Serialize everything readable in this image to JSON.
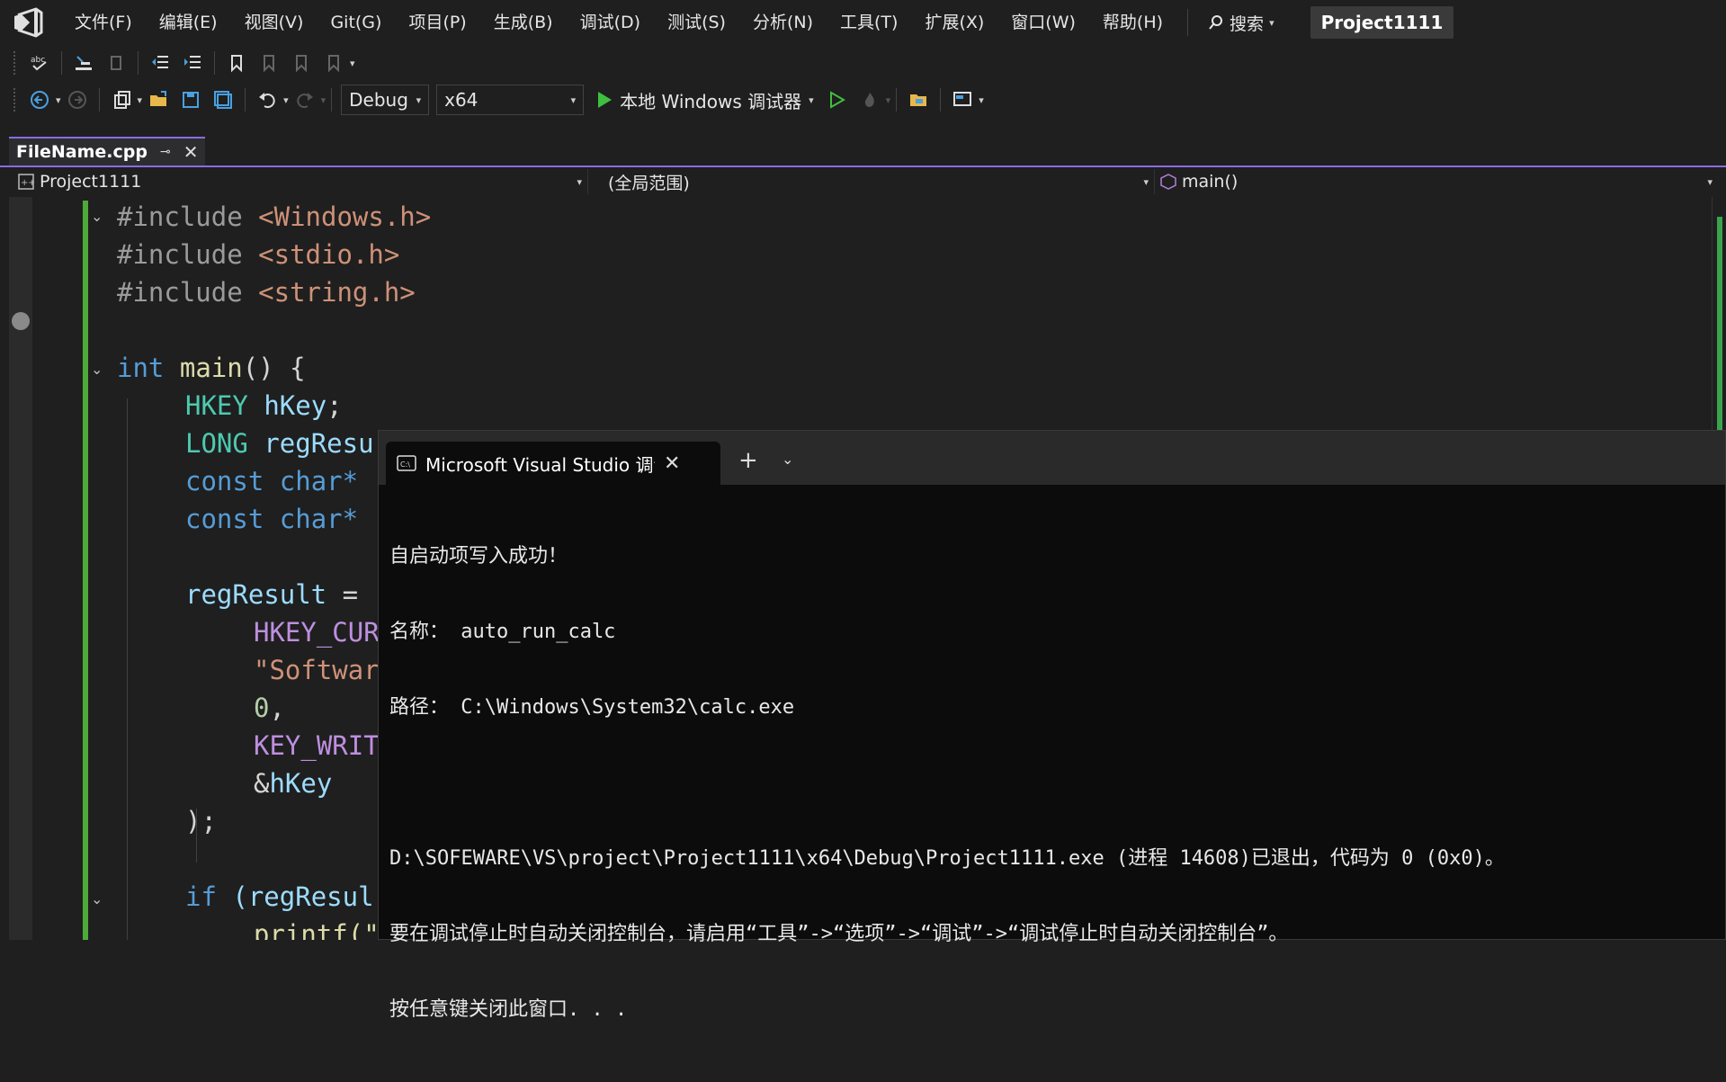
{
  "menu": {
    "items": [
      "文件(F)",
      "编辑(E)",
      "视图(V)",
      "Git(G)",
      "项目(P)",
      "生成(B)",
      "调试(D)",
      "测试(S)",
      "分析(N)",
      "工具(T)",
      "扩展(X)",
      "窗口(W)",
      "帮助(H)"
    ],
    "search_label": "搜索",
    "project_name": "Project1111"
  },
  "toolbar": {
    "config": "Debug",
    "platform": "x64",
    "run_label": "本地 Windows 调试器"
  },
  "document_tab": {
    "name": "FileName.cpp"
  },
  "navbar": {
    "project": "Project1111",
    "scope": "(全局范围)",
    "member": "main()"
  },
  "code": {
    "l1_dir": "#include",
    "l1_hdr": "<Windows.h>",
    "l2_dir": "#include",
    "l2_hdr": "<stdio.h>",
    "l3_dir": "#include",
    "l3_hdr": "<string.h>",
    "l5_type": "int",
    "l5_fn": "main",
    "l5_rest": "() {",
    "l6_type": "HKEY",
    "l6_var": "hKey",
    "l6_end": ";",
    "l7_type": "LONG",
    "l7_var": "regResu",
    "l8_kw": "const",
    "l8_type": "char*",
    "l9_kw": "const",
    "l9_type": "char*",
    "l11_var": "regResult",
    "l11_op": "=",
    "l12_mac": "HKEY_CUR",
    "l13_str": "\"Softwar",
    "l14_num": "0",
    "l14_end": ",",
    "l15_mac": "KEY_WRIT",
    "l16_amp": "&",
    "l16_var": "hKey",
    "l17_end": ");",
    "l19_kw": "if",
    "l19_rest": "(regResul",
    "l20_fn": "printf(\""
  },
  "terminal": {
    "tab_title": "Microsoft Visual Studio 调试",
    "lines": [
      "自启动项写入成功！",
      "名称： auto_run_calc",
      "路径： C:\\Windows\\System32\\calc.exe",
      "",
      "D:\\SOFEWARE\\VS\\project\\Project1111\\x64\\Debug\\Project1111.exe (进程 14608)已退出，代码为 0 (0x0)。",
      "要在调试停止时自动关闭控制台，请启用“工具”->“选项”->“调试”->“调试停止时自动关闭控制台”。",
      "按任意键关闭此窗口. . ."
    ]
  }
}
